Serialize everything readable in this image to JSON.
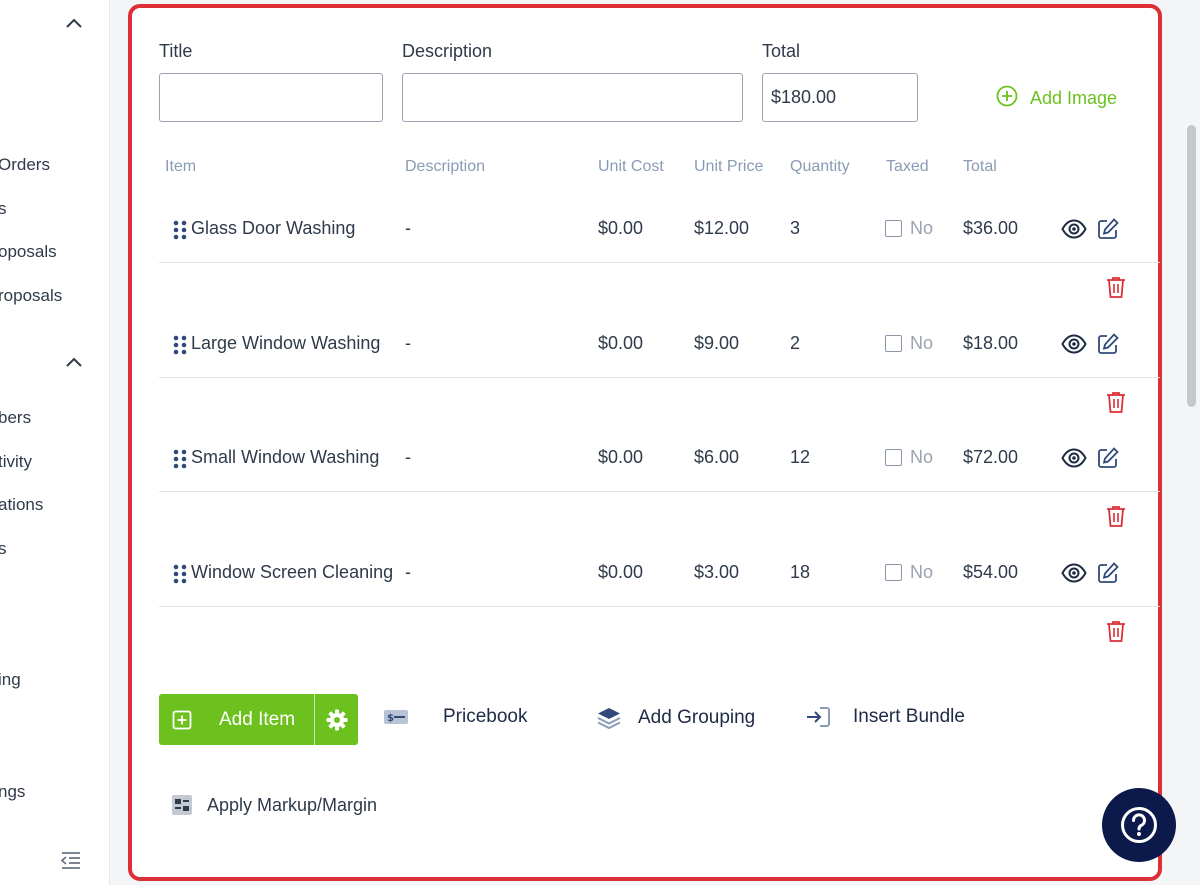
{
  "sidebar": {
    "items": [
      {
        "label": "Orders"
      },
      {
        "label": "s"
      },
      {
        "label": "oposals"
      },
      {
        "label": "roposals"
      },
      {
        "label": "bers"
      },
      {
        "label": "tivity"
      },
      {
        "label": "ations"
      },
      {
        "label": "s"
      },
      {
        "label": "ing"
      },
      {
        "label": "ngs"
      }
    ]
  },
  "form": {
    "title_label": "Title",
    "title_value": "",
    "description_label": "Description",
    "description_value": "",
    "total_label": "Total",
    "total_value": "$180.00",
    "add_image_label": "Add Image"
  },
  "table": {
    "headers": [
      "Item",
      "Description",
      "Unit Cost",
      "Unit Price",
      "Quantity",
      "Taxed",
      "Total"
    ],
    "rows": [
      {
        "item": "Glass Door Washing",
        "description": "-",
        "unit_cost": "$0.00",
        "unit_price": "$12.00",
        "quantity": "3",
        "taxed": "No",
        "total": "$36.00"
      },
      {
        "item": "Large Window Washing",
        "description": "-",
        "unit_cost": "$0.00",
        "unit_price": "$9.00",
        "quantity": "2",
        "taxed": "No",
        "total": "$18.00"
      },
      {
        "item": "Small Window Washing",
        "description": "-",
        "unit_cost": "$0.00",
        "unit_price": "$6.00",
        "quantity": "12",
        "taxed": "No",
        "total": "$72.00"
      },
      {
        "item": "Window Screen Cleaning",
        "description": "-",
        "unit_cost": "$0.00",
        "unit_price": "$3.00",
        "quantity": "18",
        "taxed": "No",
        "total": "$54.00"
      }
    ]
  },
  "actions": {
    "add_item": "Add Item",
    "pricebook": "Pricebook",
    "add_grouping": "Add Grouping",
    "insert_bundle": "Insert Bundle",
    "apply_markup": "Apply Markup/Margin"
  },
  "icons": {
    "add_image": "plus-circle-icon",
    "grip": "drag-handle-icon",
    "view": "eye-icon",
    "edit": "edit-icon",
    "delete": "trash-icon",
    "pricebook": "pricebook-icon",
    "grouping": "layers-icon",
    "bundle": "insert-icon",
    "markup": "markup-icon",
    "help": "help-icon"
  },
  "colors": {
    "accent_green": "#6cc11f",
    "danger_red": "#dc2f36",
    "header_blue_gray": "#8a9bb5",
    "navy": "#0b1a4a"
  }
}
